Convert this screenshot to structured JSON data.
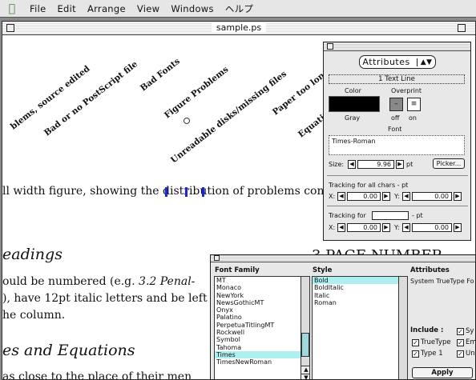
{
  "menubar": {
    "apple_icon": "apple-logo",
    "items": [
      "File",
      "Edit",
      "Arrange",
      "View",
      "Windows",
      "ヘルプ"
    ]
  },
  "document": {
    "title": "sample.ps",
    "rotated_labels": [
      "blems, source edited",
      "Bad or no PostScript file",
      "Bad Fonts",
      "Figure Problems",
      "Unreadable disks/missing files",
      "Paper too long",
      "Equatio"
    ],
    "para1": {
      "before": "ll width figure, showing the ",
      "selected": "distribu",
      "after": "tion of problems con"
    },
    "heading_readings": "eadings",
    "heading_page_number": "3     PAGE NUMBER",
    "para2_line1_a": "ould be numbered (e.g. ",
    "para2_line1_b": "3.2 Penal-",
    "para2_line2": "), have 12pt italic letters and be left",
    "para2_line3": "he column.",
    "heading_equations": "es and Equations",
    "para3_line1": "as close to the place of their men"
  },
  "attributes_palette": {
    "menu_value": "Attributes",
    "text_line": "1 Text Line",
    "color_label": "Color",
    "overprint_label": "Overprint",
    "gray_label": "Gray",
    "off_label": "off",
    "on_label": "on",
    "font_label": "Font",
    "font_value": "Times-Roman",
    "size_label": "Size:",
    "size_value": "9.96",
    "size_unit": "pt",
    "picker_label": "Picker...",
    "tracking_all_label": "Tracking for all chars - pt",
    "x_label": "X:",
    "y_label": "Y:",
    "tracking_all_x": "0.00",
    "tracking_all_y": "0.00",
    "tracking_for_label": "Tracking for",
    "tracking_for_unit": "- pt",
    "tracking_for_x": "0.00",
    "tracking_for_y": "0.00"
  },
  "font_palette": {
    "col_family": "Font Family",
    "col_style": "Style",
    "col_attributes": "Attributes",
    "families": [
      "MT",
      "Monaco",
      "NewYork",
      "NewsGothicMT",
      "Onyx",
      "Palatino",
      "PerpetuaTitlingMT",
      "Rockwell",
      "Symbol",
      "Tahoma",
      "Times",
      "TimesNewRoman"
    ],
    "selected_family": "Times",
    "styles": [
      "Bold",
      "BoldItalic",
      "Italic",
      "Roman"
    ],
    "selected_style": "Bold",
    "attributes_text": "System TrueType Fo",
    "include_label": "Include :",
    "chk_sy": "Sy",
    "chk_truetype": "TrueType",
    "chk_em": "Em",
    "chk_type1": "Type 1",
    "chk_un": "Un",
    "apply_label": "Apply"
  }
}
